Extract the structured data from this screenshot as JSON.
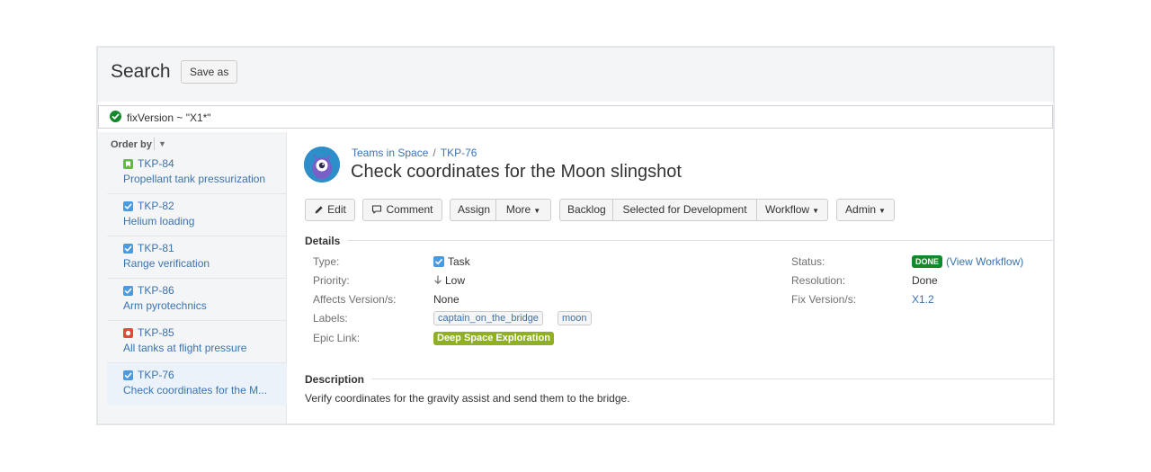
{
  "header": {
    "title": "Search",
    "save_label": "Save as"
  },
  "query": {
    "text": "fixVersion ~ \"X1*\"",
    "status_color": "#14892c"
  },
  "sidebar": {
    "order_by_label": "Order by",
    "items": [
      {
        "key": "TKP-84",
        "summary": "Propellant tank pressurization",
        "type_icon": "story-icon",
        "type_color": "#63ba3c"
      },
      {
        "key": "TKP-82",
        "summary": "Helium loading",
        "type_icon": "task-icon",
        "type_color": "#4a9ae0"
      },
      {
        "key": "TKP-81",
        "summary": "Range verification",
        "type_icon": "task-icon",
        "type_color": "#4a9ae0"
      },
      {
        "key": "TKP-86",
        "summary": "Arm pyrotechnics",
        "type_icon": "task-icon",
        "type_color": "#4a9ae0"
      },
      {
        "key": "TKP-85",
        "summary": "All tanks at flight pressure",
        "type_icon": "bug-icon",
        "type_color": "#e5493a"
      },
      {
        "key": "TKP-76",
        "summary": "Check coordinates for the M...",
        "type_icon": "task-icon",
        "type_color": "#4a9ae0",
        "selected": true
      }
    ]
  },
  "issue": {
    "project": "Teams in Space",
    "breadcrumb_separator": "/",
    "key": "TKP-76",
    "title": "Check coordinates for the Moon slingshot"
  },
  "toolbar": {
    "edit": "Edit",
    "comment": "Comment",
    "assign": "Assign",
    "more": "More",
    "backlog": "Backlog",
    "selected_for_dev": "Selected for Development",
    "workflow": "Workflow",
    "admin": "Admin"
  },
  "details": {
    "heading": "Details",
    "type_label": "Type:",
    "type_value": "Task",
    "priority_label": "Priority:",
    "priority_value": "Low",
    "affects_label": "Affects Version/s:",
    "affects_value": "None",
    "labels_label": "Labels:",
    "labels": [
      "captain_on_the_bridge",
      "moon"
    ],
    "epic_label": "Epic Link:",
    "epic_value": "Deep Space Exploration",
    "status_label": "Status:",
    "status_value": "DONE",
    "view_workflow": "(View Workflow)",
    "resolution_label": "Resolution:",
    "resolution_value": "Done",
    "fix_label": "Fix Version/s:",
    "fix_value": "X1.2"
  },
  "description": {
    "heading": "Description",
    "text": "Verify coordinates for the gravity assist and send them to the bridge."
  },
  "colors": {
    "link": "#3b73af",
    "done": "#14892c",
    "epic": "#8eb021",
    "panel_bg": "#f4f5f7"
  }
}
